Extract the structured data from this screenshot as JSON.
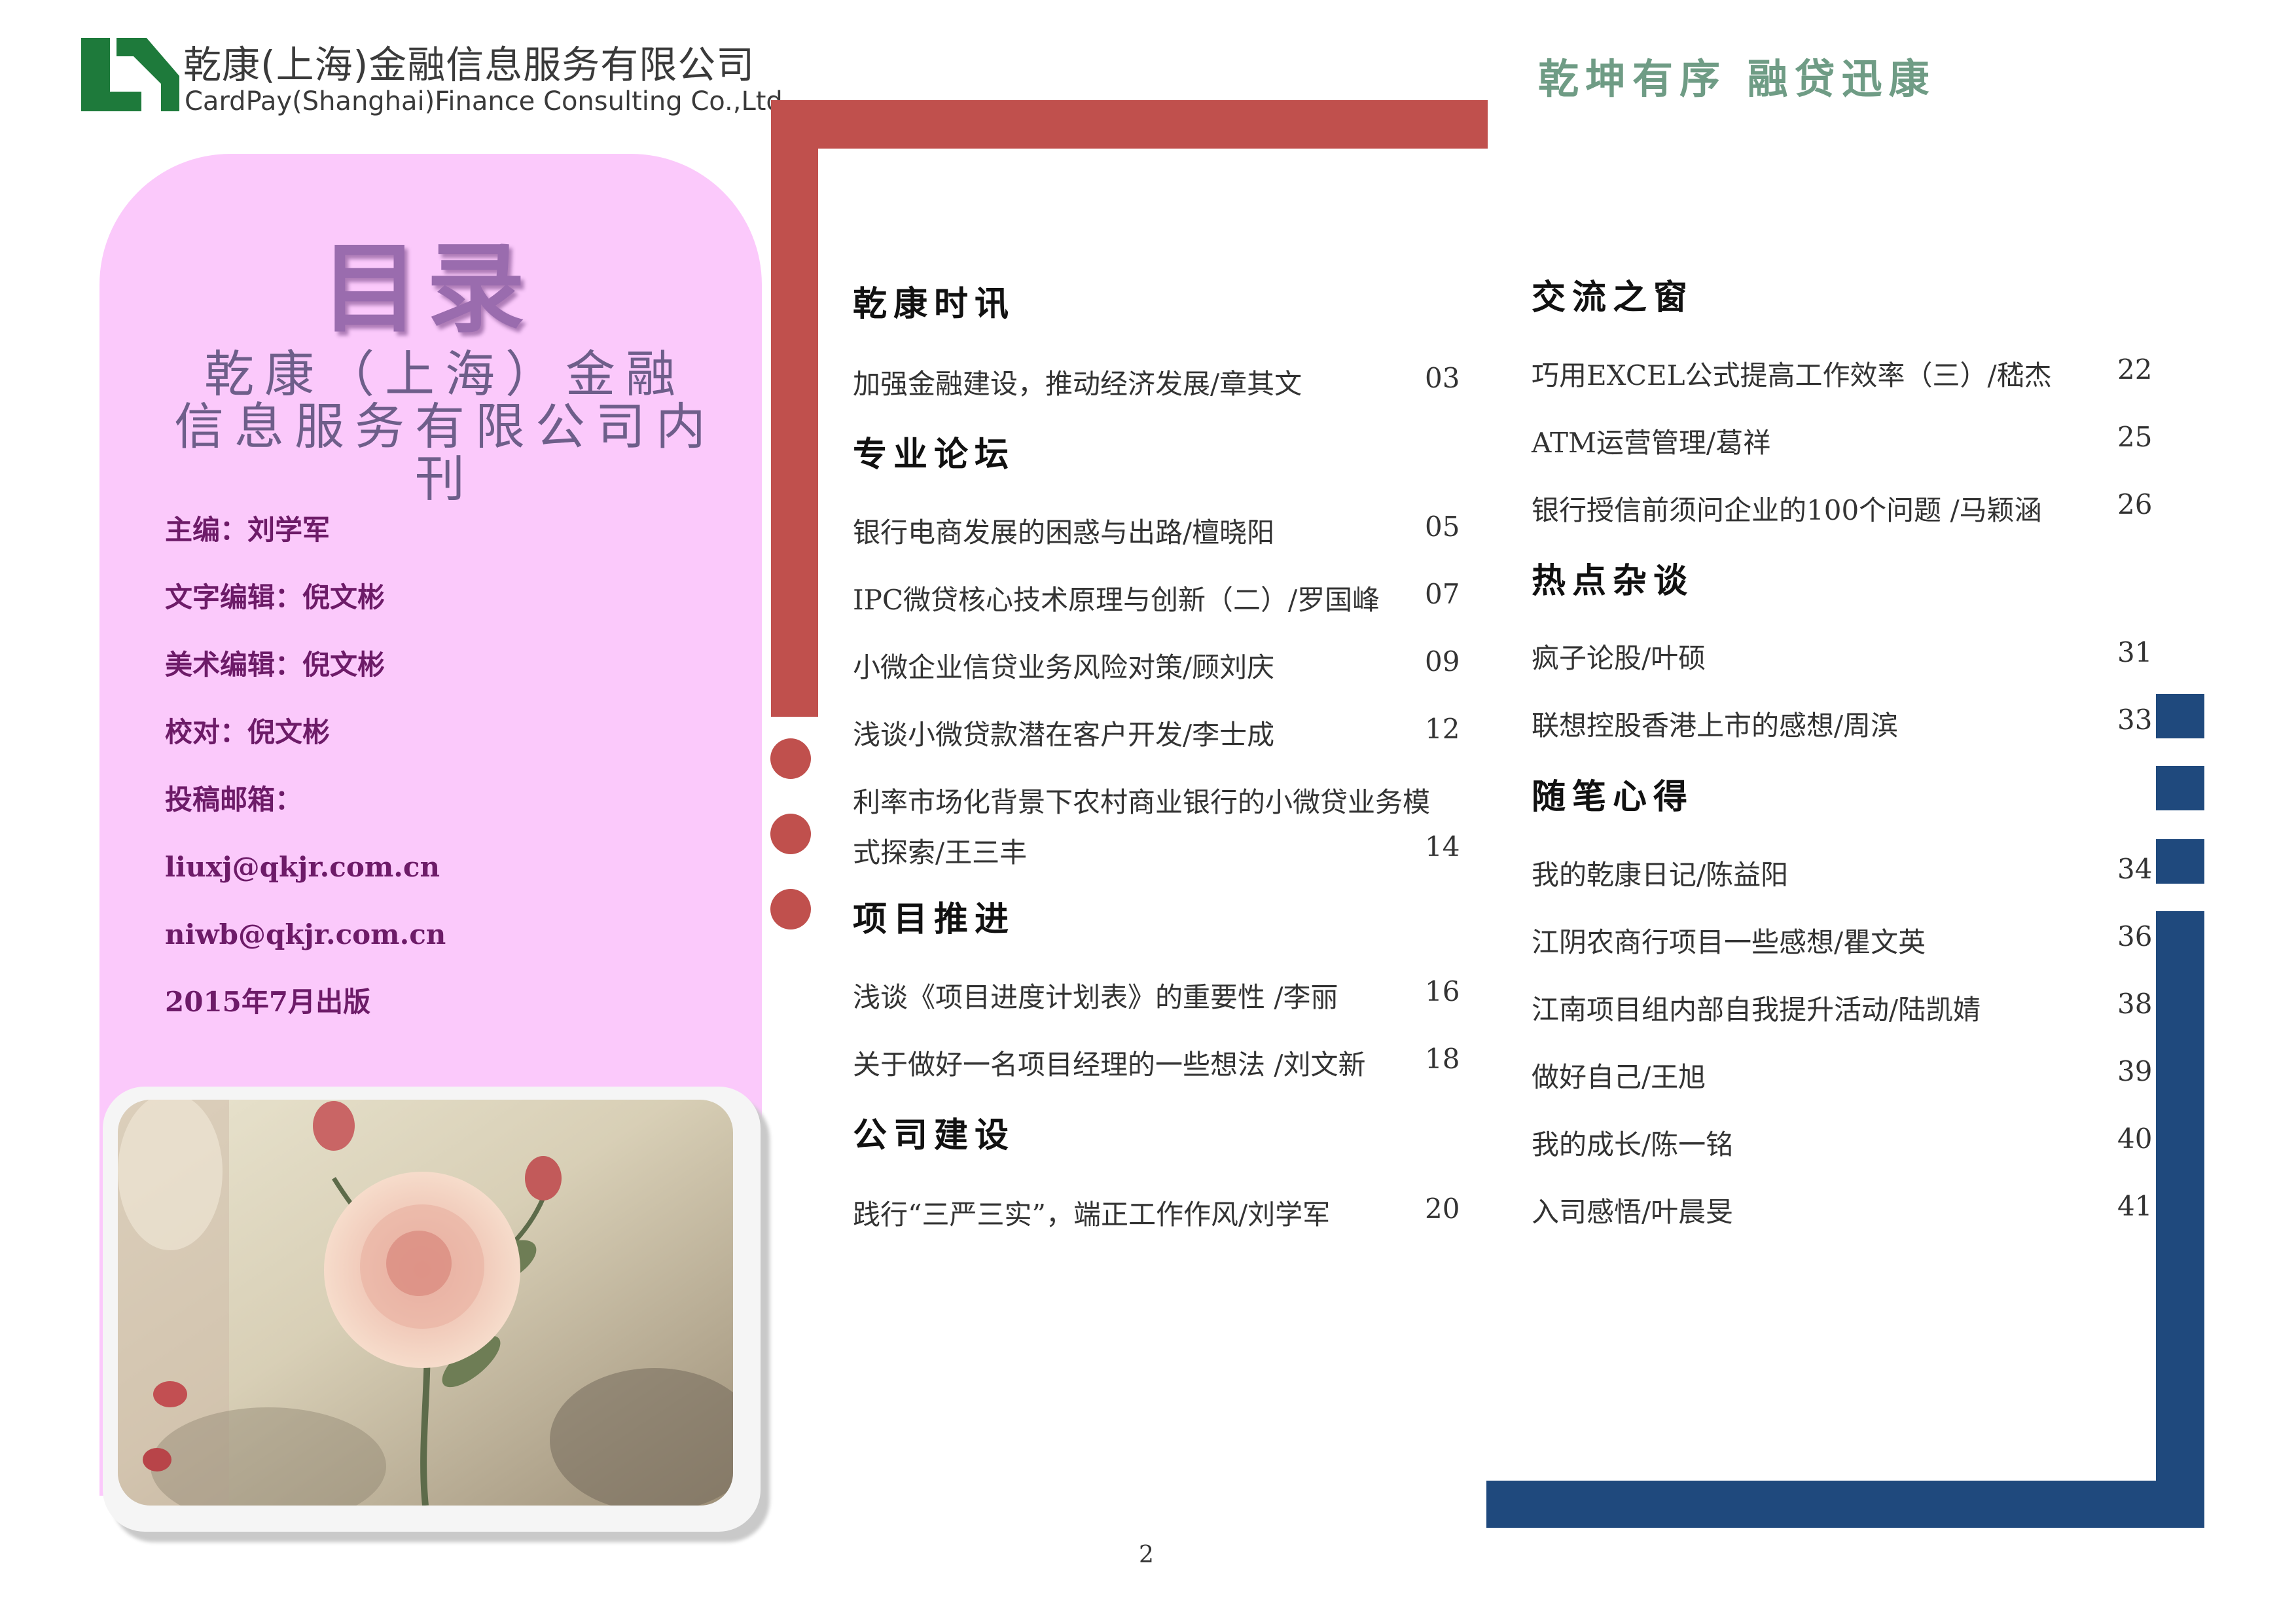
{
  "header": {
    "company_cn": "乾康(上海)金融信息服务有限公司",
    "company_en": "CardPay(Shanghai)Finance Consulting Co.,Ltd.",
    "slogan": "乾坤有序 融贷迅康",
    "logo_color": "#1e7a3b"
  },
  "cover": {
    "toc_title": "目录",
    "magazine_title_line1": "乾康（上海）金融",
    "magazine_title_line2": "信息服务有限公司内刊",
    "credits": [
      "主编：刘学军",
      "文字编辑：倪文彬",
      "美术编辑：倪文彬",
      "校对：倪文彬",
      "投稿邮箱：",
      "liuxj@qkjr.com.cn",
      "niwb@qkjr.com.cn",
      "2015年7月出版"
    ],
    "panel_color": "#fbc9fb"
  },
  "toc_left": [
    {
      "section": "乾康时讯",
      "entries": [
        {
          "title": "加强金融建设，推动经济发展/章其文",
          "page": "03"
        }
      ]
    },
    {
      "section": "专业论坛",
      "entries": [
        {
          "title": "银行电商发展的困惑与出路/檀晓阳",
          "page": "05"
        },
        {
          "title": "IPC微贷核心技术原理与创新（二）/罗国峰",
          "page": "07"
        },
        {
          "title": "小微企业信贷业务风险对策/顾刘庆",
          "page": "09"
        },
        {
          "title": "浅谈小微贷款潜在客户开发/李士成",
          "page": "12"
        },
        {
          "title": "利率市场化背景下农村商业银行的小微贷业务模",
          "title2": "式探索/王三丰",
          "page": "14"
        }
      ]
    },
    {
      "section": "项目推进",
      "entries": [
        {
          "title": "浅谈《项目进度计划表》的重要性 /李丽",
          "page": "16"
        },
        {
          "title": "关于做好一名项目经理的一些想法 /刘文新",
          "page": "18"
        }
      ]
    },
    {
      "section": "公司建设",
      "entries": [
        {
          "title": "践行“三严三实”，端正工作作风/刘学军",
          "page": "20"
        }
      ]
    }
  ],
  "toc_right": [
    {
      "section": "交流之窗",
      "entries": [
        {
          "title": "巧用EXCEL公式提高工作效率（三）/嵇杰",
          "page": "22"
        },
        {
          "title": "ATM运营管理/葛祥",
          "page": "25"
        },
        {
          "title": "银行授信前须问企业的100个问题 /马颖涵",
          "page": "26"
        }
      ]
    },
    {
      "section": "热点杂谈",
      "entries": [
        {
          "title": "疯子论股/叶硕",
          "page": "31"
        },
        {
          "title": "联想控股香港上市的感想/周滨",
          "page": "33"
        }
      ]
    },
    {
      "section": "随笔心得",
      "entries": [
        {
          "title": "我的乾康日记/陈益阳",
          "page": "34"
        },
        {
          "title": "江阴农商行项目一些感想/瞿文英",
          "page": "36"
        },
        {
          "title": "江南项目组内部自我提升活动/陆凯婧",
          "page": "38"
        },
        {
          "title": "做好自己/王旭",
          "page": "39"
        },
        {
          "title": "我的成长/陈一铭",
          "page": "40"
        },
        {
          "title": "入司感悟/叶晨旻",
          "page": "41"
        }
      ]
    }
  ],
  "accent_red": "#c0504d",
  "accent_blue": "#1f497d",
  "page_number": "2"
}
